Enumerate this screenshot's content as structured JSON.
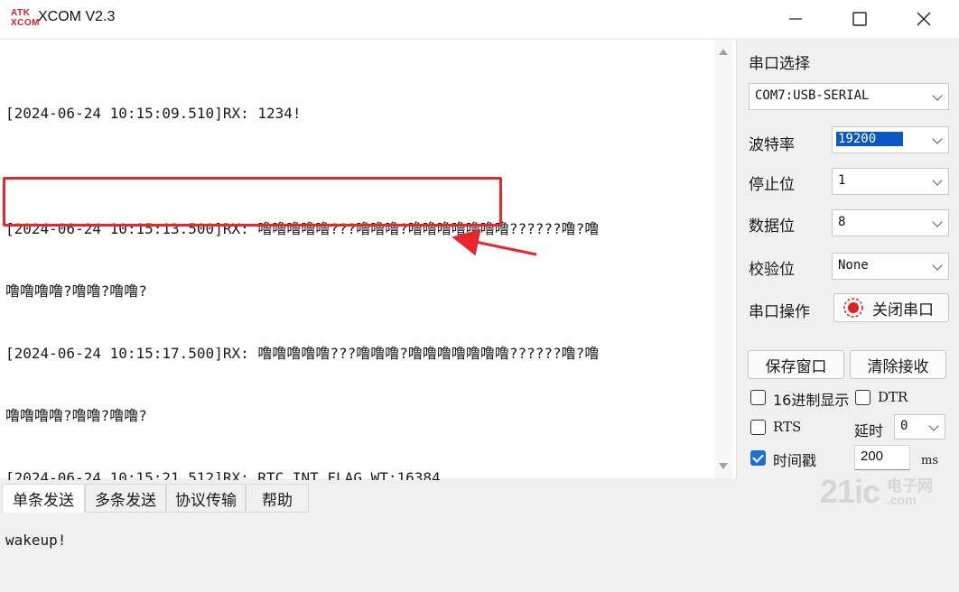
{
  "window": {
    "logo_line1": "ATK",
    "logo_line2": "XCOM",
    "title": "XCOM V2.3"
  },
  "receive": {
    "lines": [
      "[2024-06-24 10:15:09.510]RX: 1234!",
      "[2024-06-24 10:15:13.500]RX: 噜噜噜噜噜???噜噜噜?噜噜噜噜噜噜噜??????噜?噜",
      "噜噜噜噜?噜噜?噜噜?",
      "[2024-06-24 10:15:17.500]RX: 噜噜噜噜噜???噜噜噜?噜噜噜噜噜噜噜??????噜?噜",
      "噜噜噜噜?噜噜?噜噜?",
      "[2024-06-24 10:15:21.512]RX: RTC_INT_FLAG_WT:16384",
      "wakeup!"
    ]
  },
  "panel": {
    "port_select_label": "串口选择",
    "port_value": "COM7:USB-SERIAL",
    "baud_label": "波特率",
    "baud_value": "19200",
    "stop_label": "停止位",
    "stop_value": "1",
    "data_label": "数据位",
    "data_value": "8",
    "parity_label": "校验位",
    "parity_value": "None",
    "port_op_label": "串口操作",
    "close_port_button": "关闭串口",
    "save_window_button": "保存窗口",
    "clear_receive_button": "清除接收",
    "hex_display_label": "16进制显示",
    "dtr_label": "DTR",
    "rts_label": "RTS",
    "delay_label": "延时",
    "delay_value": "0",
    "timestamp_label": "时间戳",
    "timestamp_value": "200",
    "timestamp_unit": "ms"
  },
  "tabs": [
    "单条发送",
    "多条发送",
    "协议传输",
    "帮助"
  ],
  "watermark": {
    "big": "21ic",
    "small": "电子网",
    "url": ".com"
  },
  "colors": {
    "highlight": "#e8262e",
    "selection": "#0a58c8",
    "checkbox_checked": "#1f6fd1"
  }
}
